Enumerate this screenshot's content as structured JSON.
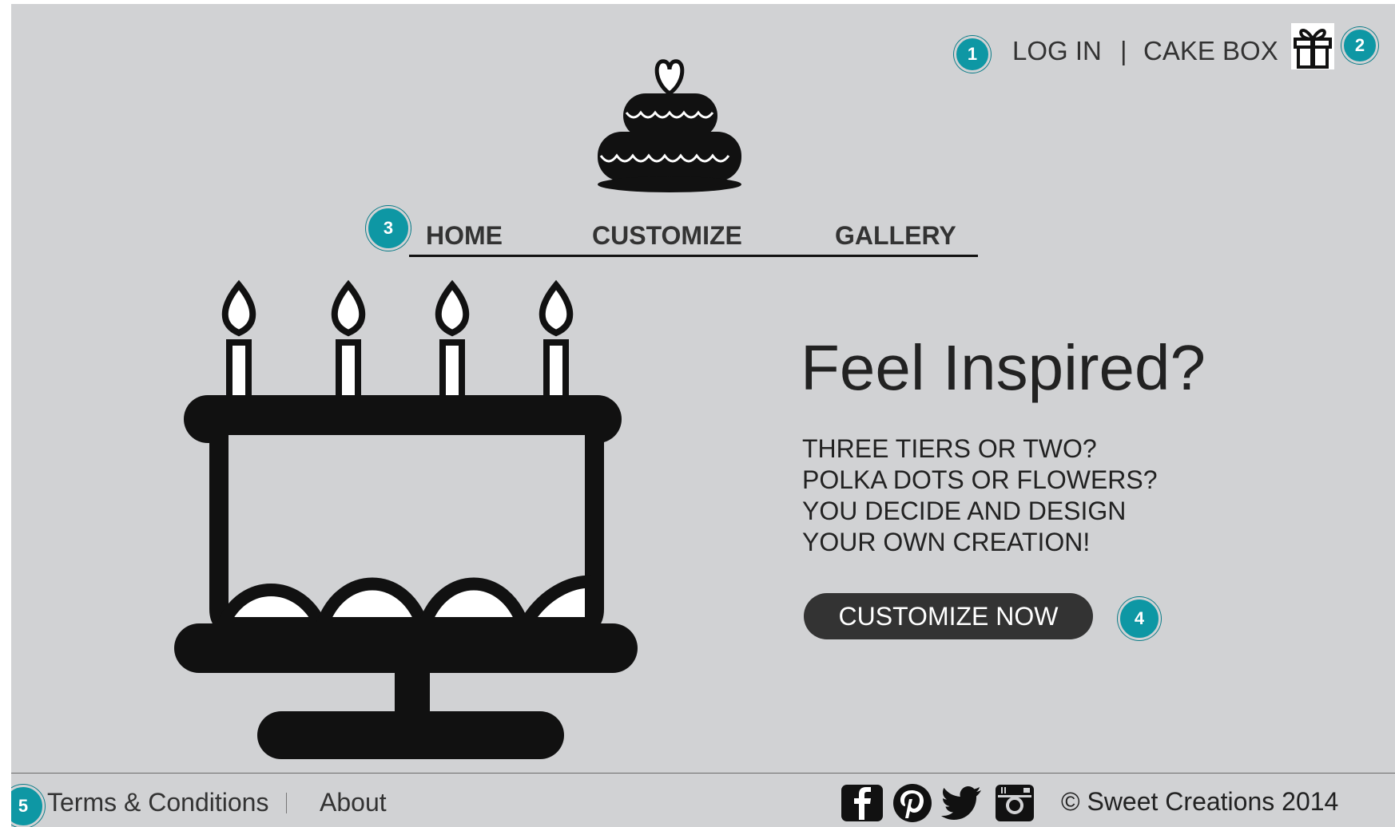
{
  "header": {
    "login_label": "LOG IN",
    "separator": "|",
    "cake_box_label": "CAKE BOX",
    "gift_icon": "gift-icon",
    "logo_icon": "cake-logo-icon"
  },
  "nav": {
    "items": [
      {
        "label": "HOME"
      },
      {
        "label": "CUSTOMIZE"
      },
      {
        "label": "GALLERY"
      }
    ]
  },
  "hero": {
    "image_icon": "birthday-cake-stand-icon",
    "headline": "Feel Inspired?",
    "lines": [
      "THREE TIERS OR TWO?",
      "POLKA DOTS OR FLOWERS?",
      "YOU DECIDE AND DESIGN",
      "YOUR OWN CREATION!"
    ],
    "cta_label": "CUSTOMIZE NOW"
  },
  "annotations": [
    "1",
    "2",
    "3",
    "4",
    "5"
  ],
  "footer": {
    "terms_label": "Terms & Conditions",
    "about_label": "About",
    "social_icons": [
      "facebook-icon",
      "pinterest-icon",
      "twitter-icon",
      "instagram-icon"
    ],
    "copyright": "© Sweet Creations 2014"
  },
  "colors": {
    "background": "#d1d2d4",
    "badge": "#0e97a4",
    "text": "#333333",
    "button": "#333333"
  }
}
